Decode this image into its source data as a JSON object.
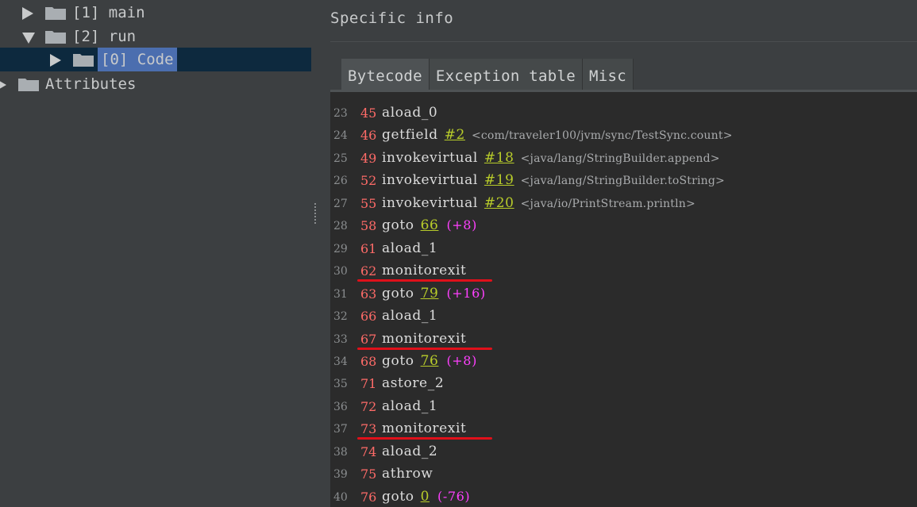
{
  "tree": {
    "items": [
      {
        "label": "[1] main",
        "state": "collapsed"
      },
      {
        "label": "[2] run",
        "state": "expanded"
      },
      {
        "label": "[0] Code",
        "state": "collapsed",
        "selected": true
      },
      {
        "label": "Attributes",
        "state": "collapsed"
      }
    ]
  },
  "panel": {
    "title": "Specific info",
    "tabs": [
      {
        "label": "Bytecode",
        "active": true
      },
      {
        "label": "Exception table",
        "active": false
      },
      {
        "label": "Misc",
        "active": false
      }
    ]
  },
  "code": {
    "lines": [
      {
        "line": "23",
        "pc": "45",
        "op": "aload_0"
      },
      {
        "line": "24",
        "pc": "46",
        "op": "getfield",
        "arg": "#2",
        "ref": "<com/traveler100/jvm/sync/TestSync.count>"
      },
      {
        "line": "25",
        "pc": "49",
        "op": "invokevirtual",
        "arg": "#18",
        "ref": "<java/lang/StringBuilder.append>"
      },
      {
        "line": "26",
        "pc": "52",
        "op": "invokevirtual",
        "arg": "#19",
        "ref": "<java/lang/StringBuilder.toString>"
      },
      {
        "line": "27",
        "pc": "55",
        "op": "invokevirtual",
        "arg": "#20",
        "ref": "<java/io/PrintStream.println>"
      },
      {
        "line": "28",
        "pc": "58",
        "op": "goto",
        "arg": "66",
        "offset": "(+8)"
      },
      {
        "line": "29",
        "pc": "61",
        "op": "aload_1"
      },
      {
        "line": "30",
        "pc": "62",
        "op": "monitorexit",
        "underlined": true
      },
      {
        "line": "31",
        "pc": "63",
        "op": "goto",
        "arg": "79",
        "offset": "(+16)"
      },
      {
        "line": "32",
        "pc": "66",
        "op": "aload_1"
      },
      {
        "line": "33",
        "pc": "67",
        "op": "monitorexit",
        "underlined": true
      },
      {
        "line": "34",
        "pc": "68",
        "op": "goto",
        "arg": "76",
        "offset": "(+8)"
      },
      {
        "line": "35",
        "pc": "71",
        "op": "astore_2"
      },
      {
        "line": "36",
        "pc": "72",
        "op": "aload_1"
      },
      {
        "line": "37",
        "pc": "73",
        "op": "monitorexit",
        "underlined": true
      },
      {
        "line": "38",
        "pc": "74",
        "op": "aload_2"
      },
      {
        "line": "39",
        "pc": "75",
        "op": "athrow"
      },
      {
        "line": "40",
        "pc": "76",
        "op": "goto",
        "arg": "0",
        "offset": "(-76)"
      }
    ]
  },
  "colors": {
    "background": "#3c3f41",
    "editor": "#2b2b2b",
    "selection": "#4b6eaf",
    "pc_number": "#ff6b68",
    "argument": "#b8cc2a",
    "offset": "#ff40ff",
    "annotation_underline": "#e0101a"
  }
}
